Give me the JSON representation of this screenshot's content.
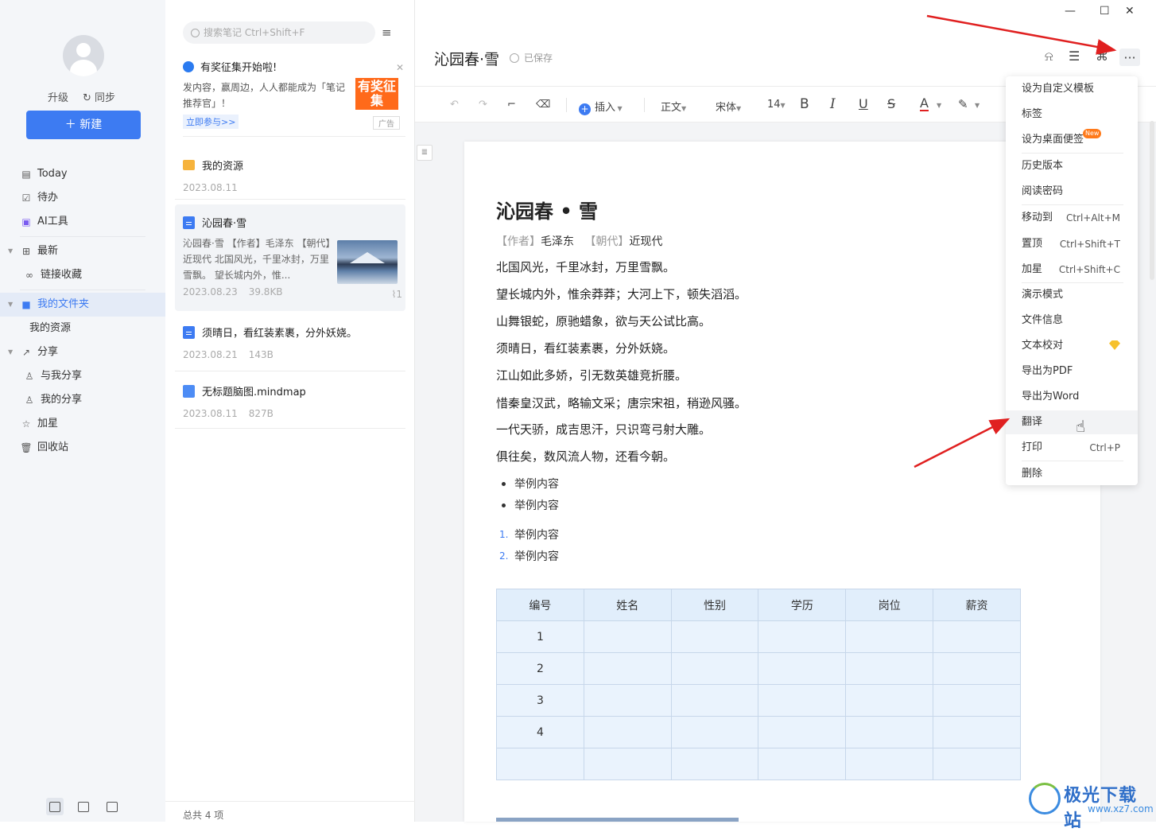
{
  "sidebar": {
    "upgrade": "升级",
    "sync": "同步",
    "new_button": "新建",
    "items": [
      {
        "label": "Today",
        "icon": "calendar-icon"
      },
      {
        "label": "待办",
        "icon": "checkbox-icon"
      },
      {
        "label": "AI工具",
        "icon": "ai-icon"
      },
      {
        "label": "最新",
        "icon": "grid-icon"
      },
      {
        "label": "链接收藏",
        "icon": "link-icon"
      },
      {
        "label": "我的文件夹",
        "icon": "folder-icon"
      },
      {
        "label": "我的资源",
        "icon": ""
      },
      {
        "label": "分享",
        "icon": "share-icon"
      },
      {
        "label": "与我分享",
        "icon": "user-icon"
      },
      {
        "label": "我的分享",
        "icon": "user-icon"
      },
      {
        "label": "加星",
        "icon": "star-icon"
      },
      {
        "label": "回收站",
        "icon": "trash-icon"
      }
    ]
  },
  "notes_list": {
    "search_placeholder": "搜索笔记 Ctrl+Shift+F",
    "ad": {
      "title": "有奖征集开始啦!",
      "desc": "发内容，赢周边，人人都能成为「笔记推荐官」！",
      "link": "立即参与>>",
      "image_text": "有奖征集",
      "tag": "广告"
    },
    "cards": [
      {
        "title": "我的资源",
        "date": "2023.08.11",
        "size": ""
      },
      {
        "title": "沁园春·雪",
        "body": "沁园春·雪 【作者】毛泽东 【朝代】近现代 北国风光，千里冰封，万里雪飘。 望长城内外，惟...",
        "date": "2023.08.23",
        "size": "39.8KB",
        "attach": "1"
      },
      {
        "title": "须晴日，看红装素裹，分外妖娆。",
        "date": "2023.08.21",
        "size": "143B"
      },
      {
        "title": "无标题脑图.mindmap",
        "date": "2023.08.11",
        "size": "827B"
      }
    ],
    "total": "总共 4 项"
  },
  "editor": {
    "title": "沁园春·雪",
    "saved": "已保存",
    "toolbar": {
      "insert": "插入",
      "style": "正文",
      "font": "宋体",
      "size": "14",
      "bold": "B",
      "italic": "I",
      "underline": "U",
      "strike": "S",
      "color": "A"
    },
    "poem_title": "沁园春 • 雪",
    "author_line": {
      "author_label": "【作者】",
      "author": "毛泽东",
      "dynasty_label": "【朝代】",
      "dynasty": "近现代"
    },
    "lines": [
      "北国风光，千里冰封，万里雪飘。",
      "望长城内外，惟余莽莽；大河上下，顿失滔滔。",
      "山舞银蛇，原驰蜡象，欲与天公试比高。",
      "须晴日，看红装素裹，分外妖娆。",
      "江山如此多娇，引无数英雄竞折腰。",
      "惜秦皇汉武，略输文采；唐宗宋祖，稍逊风骚。",
      "一代天骄，成吉思汗，只识弯弓射大雕。",
      "俱往矣，数风流人物，还看今朝。"
    ],
    "bullets": [
      "举例内容",
      "举例内容"
    ],
    "numbered": [
      {
        "num": "1.",
        "text": "举例内容"
      },
      {
        "num": "2.",
        "text": "举例内容"
      }
    ],
    "table": {
      "headers": [
        "编号",
        "姓名",
        "性别",
        "学历",
        "岗位",
        "薪资"
      ],
      "rows": [
        [
          "1",
          "",
          "",
          "",
          "",
          ""
        ],
        [
          "2",
          "",
          "",
          "",
          "",
          ""
        ],
        [
          "3",
          "",
          "",
          "",
          "",
          ""
        ],
        [
          "4",
          "",
          "",
          "",
          "",
          ""
        ],
        [
          "",
          "",
          "",
          "",
          "",
          ""
        ]
      ]
    }
  },
  "more_menu": {
    "items": [
      {
        "label": "设为自定义模板",
        "shortcut": ""
      },
      {
        "label": "标签",
        "shortcut": ""
      },
      {
        "label": "设为桌面便签",
        "shortcut": "",
        "badge": "New"
      },
      {
        "label": "历史版本",
        "shortcut": ""
      },
      {
        "label": "阅读密码",
        "shortcut": ""
      },
      {
        "label": "移动到",
        "shortcut": "Ctrl+Alt+M"
      },
      {
        "label": "置顶",
        "shortcut": "Ctrl+Shift+T"
      },
      {
        "label": "加星",
        "shortcut": "Ctrl+Shift+C"
      },
      {
        "label": "演示模式",
        "shortcut": ""
      },
      {
        "label": "文件信息",
        "shortcut": ""
      },
      {
        "label": "文本校对",
        "shortcut": ""
      },
      {
        "label": "导出为PDF",
        "shortcut": ""
      },
      {
        "label": "导出为Word",
        "shortcut": ""
      },
      {
        "label": "翻译",
        "shortcut": ""
      },
      {
        "label": "打印",
        "shortcut": "Ctrl+P"
      },
      {
        "label": "删除",
        "shortcut": ""
      }
    ]
  },
  "watermark": {
    "name": "极光下载站",
    "url": "www.xz7.com"
  },
  "colors": {
    "accent": "#3d7bf2",
    "arrow": "#e02020",
    "table_fill": "#eaf3fd"
  }
}
